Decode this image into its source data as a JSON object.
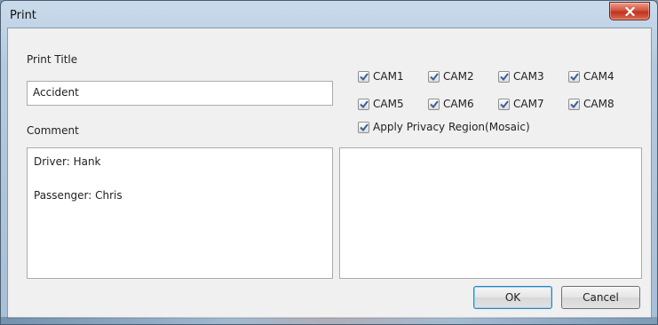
{
  "window": {
    "title": "Print"
  },
  "print_title": {
    "label": "Print Title",
    "value": "Accident"
  },
  "comment": {
    "label": "Comment",
    "lines": [
      "Driver: Hank",
      "",
      "Passenger: Chris"
    ]
  },
  "cameras": [
    {
      "label": "CAM1",
      "checked": true
    },
    {
      "label": "CAM2",
      "checked": true
    },
    {
      "label": "CAM3",
      "checked": true
    },
    {
      "label": "CAM4",
      "checked": true
    },
    {
      "label": "CAM5",
      "checked": true
    },
    {
      "label": "CAM6",
      "checked": true
    },
    {
      "label": "CAM7",
      "checked": true
    },
    {
      "label": "CAM8",
      "checked": true
    }
  ],
  "privacy": {
    "label": "Apply Privacy Region(Mosaic)",
    "checked": true
  },
  "buttons": {
    "ok": "OK",
    "cancel": "Cancel"
  },
  "colors": {
    "check_mark": "#3a5f9a",
    "title_bar": "#b6cadf",
    "close_button": "#c1321b"
  },
  "icons": {
    "close": "close-icon",
    "check": "checkmark-icon"
  }
}
